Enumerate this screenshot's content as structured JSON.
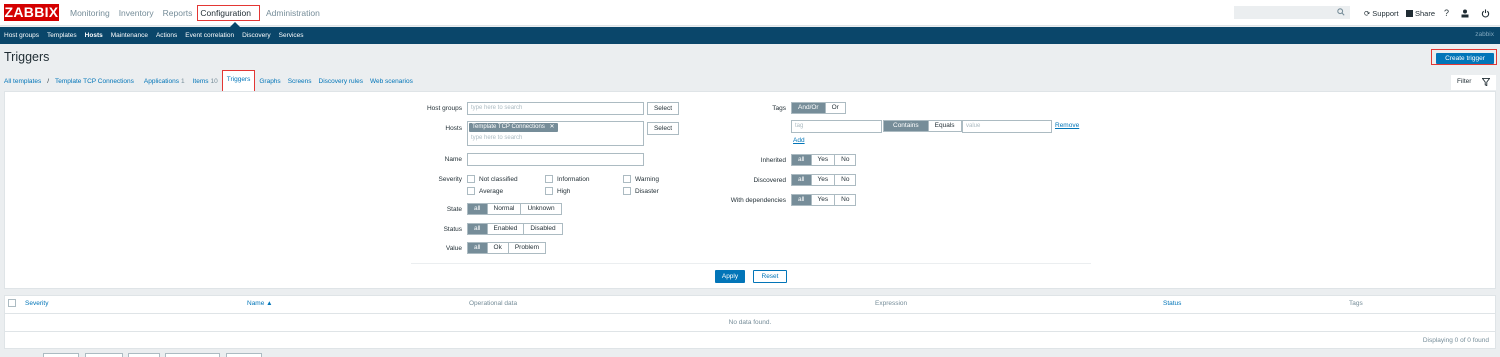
{
  "logo": "ZABBIX",
  "top_menu": [
    "Monitoring",
    "Inventory",
    "Reports",
    "Configuration",
    "Administration"
  ],
  "top_active": "Configuration",
  "top_right": {
    "support": "Support",
    "share": "Share",
    "help": "?",
    "search_icon": "search-icon",
    "user_icon": "user-icon",
    "power_icon": "power-icon"
  },
  "sub_menu": [
    "Host groups",
    "Templates",
    "Hosts",
    "Maintenance",
    "Actions",
    "Event correlation",
    "Discovery",
    "Services"
  ],
  "sub_active": "Hosts",
  "server_name": "zabbix",
  "page_title": "Triggers",
  "create_button": "Create trigger",
  "breadcrumbs": {
    "all_templates": "All templates",
    "separator": "/",
    "template": "Template TCP Connections",
    "applications": "Applications",
    "applications_count": "1",
    "items": "Items",
    "items_count": "10",
    "triggers": "Triggers",
    "graphs": "Graphs",
    "screens": "Screens",
    "discovery_rules": "Discovery rules",
    "web_scenarios": "Web scenarios"
  },
  "filter_tab": {
    "label": "Filter",
    "icon": "filter-icon"
  },
  "filter": {
    "host_groups_label": "Host groups",
    "host_groups_placeholder": "type here to search",
    "select": "Select",
    "hosts_label": "Hosts",
    "hosts_chip": "Template TCP Connections",
    "hosts_placeholder": "type here to search",
    "name_label": "Name",
    "name_value": "",
    "severity_label": "Severity",
    "severities": [
      "Not classified",
      "Information",
      "Warning",
      "Average",
      "High",
      "Disaster"
    ],
    "state_label": "State",
    "state_options": [
      "all",
      "Normal",
      "Unknown"
    ],
    "status_label": "Status",
    "status_options": [
      "all",
      "Enabled",
      "Disabled"
    ],
    "value_label": "Value",
    "value_options": [
      "all",
      "Ok",
      "Problem"
    ],
    "tags_label": "Tags",
    "tags_mode": [
      "And/Or",
      "Or"
    ],
    "tag_placeholder": "tag",
    "tag_ops": [
      "Contains",
      "Equals"
    ],
    "value_placeholder": "value",
    "remove": "Remove",
    "add": "Add",
    "inherited_label": "Inherited",
    "inherited_options": [
      "all",
      "Yes",
      "No"
    ],
    "discovered_label": "Discovered",
    "discovered_options": [
      "all",
      "Yes",
      "No"
    ],
    "with_dependencies_label": "With dependencies",
    "with_dependencies_options": [
      "all",
      "Yes",
      "No"
    ],
    "apply": "Apply",
    "reset": "Reset"
  },
  "table": {
    "columns": [
      "Severity",
      "Name ▲",
      "Operational data",
      "Expression",
      "Status",
      "Tags"
    ],
    "no_data": "No data found.",
    "displaying": "Displaying 0 of 0 found"
  },
  "colors": {
    "brand": "#d40000",
    "nav": "#0a466a",
    "accent": "#0275b8",
    "highlight": "#e33734"
  }
}
